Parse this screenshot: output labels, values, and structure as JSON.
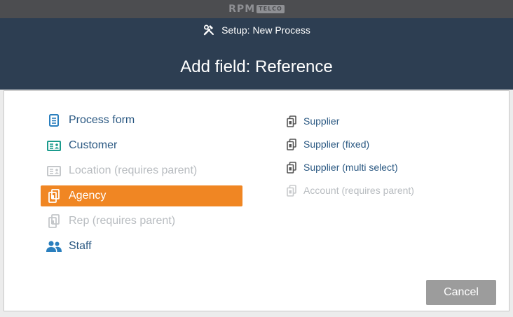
{
  "brand": {
    "logo_main": "RPM",
    "logo_sub": "TELCO"
  },
  "header": {
    "setup_label": "Setup: New Process",
    "title": "Add field: Reference"
  },
  "left_items": [
    {
      "label": "Process form",
      "icon": "form-icon",
      "state": "normal"
    },
    {
      "label": "Customer",
      "icon": "customer-card-icon",
      "state": "normal"
    },
    {
      "label": "Location (requires parent)",
      "icon": "location-card-icon",
      "state": "disabled"
    },
    {
      "label": "Agency",
      "icon": "agency-icon",
      "state": "selected"
    },
    {
      "label": "Rep (requires parent)",
      "icon": "rep-icon",
      "state": "disabled"
    },
    {
      "label": "Staff",
      "icon": "staff-icon",
      "state": "normal"
    }
  ],
  "right_items": [
    {
      "label": "Supplier",
      "icon": "supplier-icon",
      "state": "normal"
    },
    {
      "label": "Supplier (fixed)",
      "icon": "supplier-icon",
      "state": "normal"
    },
    {
      "label": "Supplier (multi select)",
      "icon": "supplier-icon",
      "state": "normal"
    },
    {
      "label": "Account (requires parent)",
      "icon": "account-icon",
      "state": "disabled"
    }
  ],
  "actions": {
    "cancel_label": "Cancel"
  },
  "colors": {
    "header_bg": "#2d3e52",
    "topbar_bg": "#4c4d50",
    "selected_bg": "#f08623",
    "link": "#2a5882",
    "disabled": "#b8bcc0",
    "cancel_bg": "#9c9c9c"
  }
}
